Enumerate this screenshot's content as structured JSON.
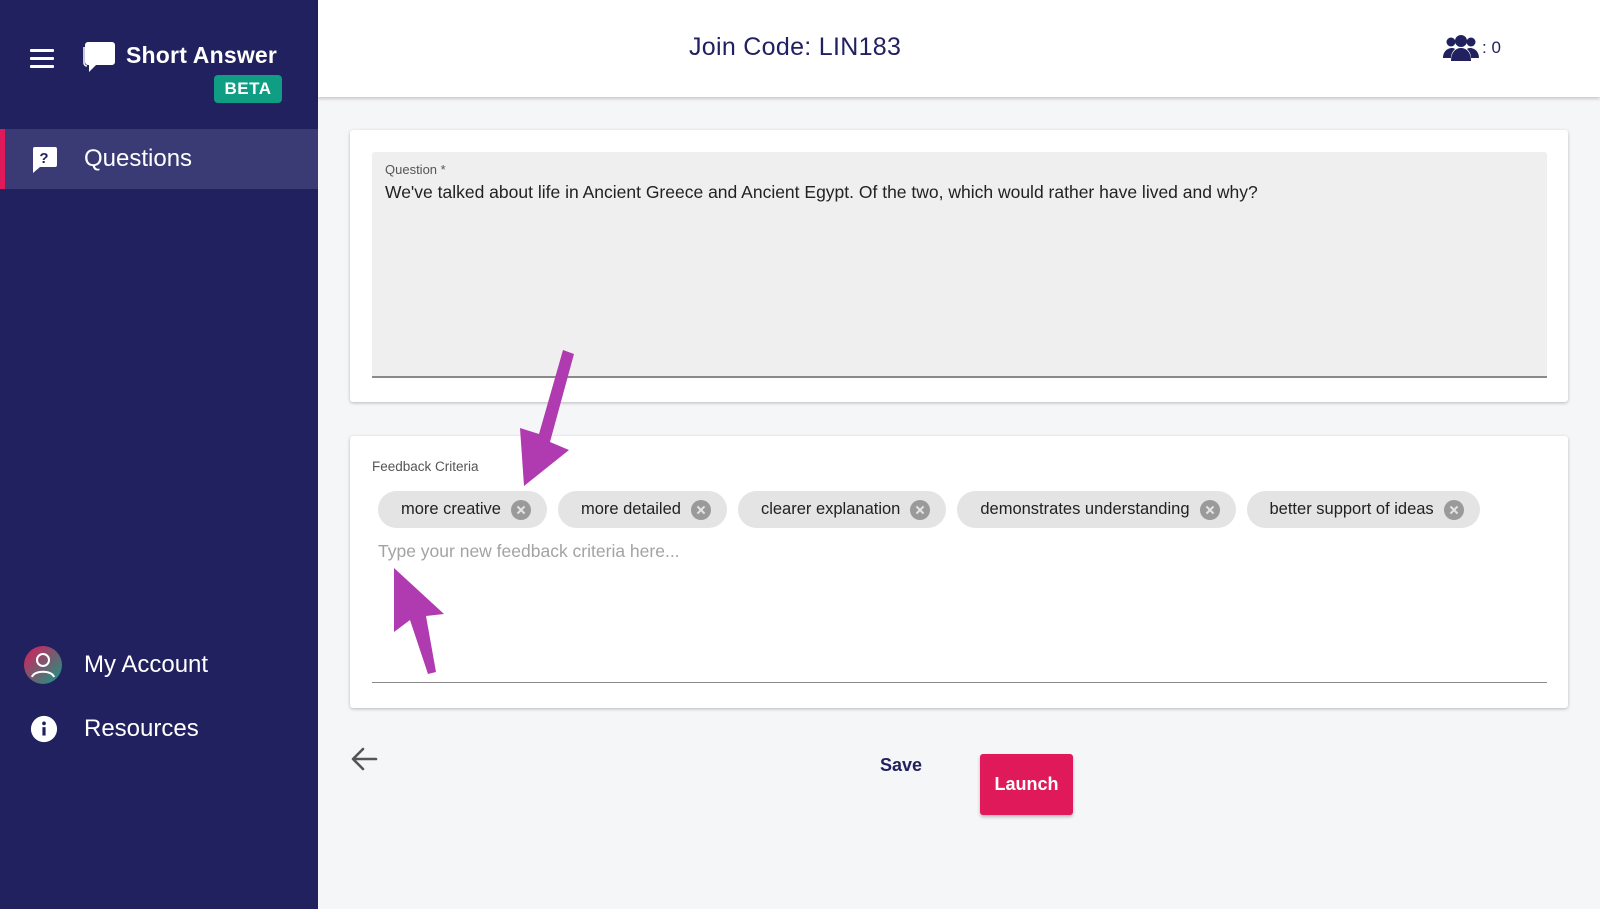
{
  "sidebar": {
    "brand": {
      "name": "Short Answer",
      "badge": "BETA"
    },
    "nav": {
      "questions": "Questions",
      "my_account": "My Account",
      "resources": "Resources"
    }
  },
  "header": {
    "join_code": "Join Code: LIN183",
    "participants_count": ": 0"
  },
  "question": {
    "label": "Question *",
    "value": "We've talked about life in Ancient Greece and Ancient Egypt. Of the two, which would rather have lived and why?"
  },
  "criteria": {
    "label": "Feedback Criteria",
    "chips": [
      "more creative",
      "more detailed",
      "clearer explanation",
      "demonstrates understanding",
      "better support of ideas"
    ],
    "placeholder": "Type your new feedback criteria here..."
  },
  "actions": {
    "save": "Save",
    "launch": "Launch"
  },
  "colors": {
    "sidebar_bg": "#22215f",
    "accent": "#e0195a",
    "beta_badge": "#0f9d84",
    "annotation": "#b03ab0"
  },
  "icons": [
    "menu-icon",
    "chat-bubble-icon",
    "question-icon",
    "user-avatar-icon",
    "info-icon",
    "users-icon",
    "close-icon",
    "back-arrow-icon"
  ]
}
